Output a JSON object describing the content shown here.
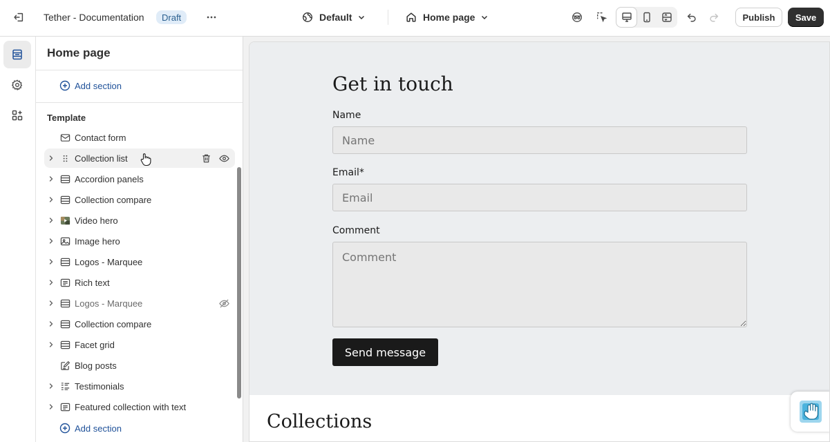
{
  "topbar": {
    "app_title": "Tether - Documentation",
    "draft_badge": "Draft",
    "theme_select": "Default",
    "page_select": "Home page",
    "publish_label": "Publish",
    "save_label": "Save"
  },
  "sidebar": {
    "title": "Home page",
    "add_section_label": "Add section",
    "template_heading": "Template",
    "items": [
      {
        "label": "Contact form",
        "icon": "contact-form-icon",
        "expandable": false
      },
      {
        "label": "Collection list",
        "icon": "drag-handle-icon",
        "expandable": true,
        "hovered": true
      },
      {
        "label": "Accordion panels",
        "icon": "section-icon",
        "expandable": true
      },
      {
        "label": "Collection compare",
        "icon": "section-icon",
        "expandable": true
      },
      {
        "label": "Video hero",
        "icon": "video-thumbnail-icon",
        "expandable": true
      },
      {
        "label": "Image hero",
        "icon": "image-icon",
        "expandable": true
      },
      {
        "label": "Logos - Marquee",
        "icon": "section-icon",
        "expandable": true
      },
      {
        "label": "Rich text",
        "icon": "text-icon",
        "expandable": true
      },
      {
        "label": "Logos - Marquee",
        "icon": "section-icon",
        "expandable": true,
        "hidden": true
      },
      {
        "label": "Collection compare",
        "icon": "section-icon",
        "expandable": true
      },
      {
        "label": "Facet grid",
        "icon": "section-icon",
        "expandable": true
      },
      {
        "label": "Blog posts",
        "icon": "blog-icon",
        "expandable": false
      },
      {
        "label": "Testimonials",
        "icon": "list-icon",
        "expandable": true
      },
      {
        "label": "Featured collection with text",
        "icon": "text-icon",
        "expandable": true
      }
    ]
  },
  "preview": {
    "contact_title": "Get in touch",
    "name_label": "Name",
    "name_placeholder": "Name",
    "email_label": "Email*",
    "email_placeholder": "Email",
    "comment_label": "Comment",
    "comment_placeholder": "Comment",
    "send_label": "Send message",
    "collections_title": "Collections"
  },
  "colors": {
    "accent": "#1f5199",
    "primary_button": "#303030",
    "draft_badge_bg": "#e0ecf8",
    "preview_section_bg": "#eceef0"
  }
}
